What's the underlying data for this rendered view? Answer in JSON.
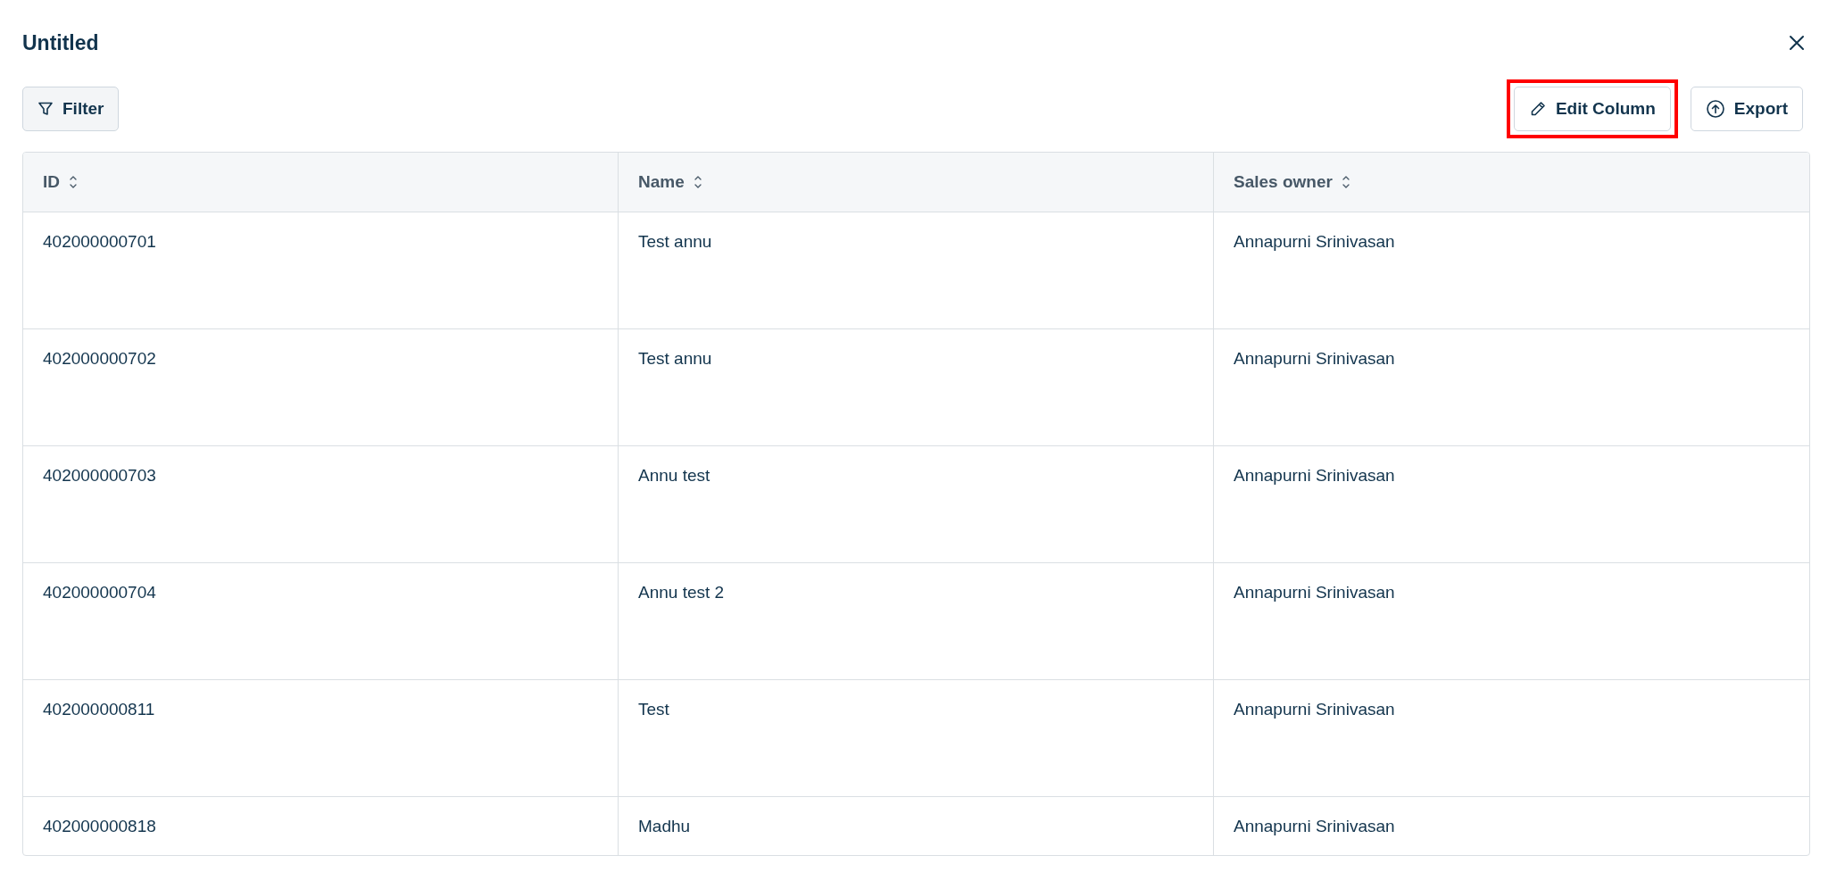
{
  "window": {
    "title": "Untitled"
  },
  "toolbar": {
    "filter": {
      "label": "Filter"
    },
    "buttons": [
      {
        "kind": "edit",
        "label": "Edit Column",
        "highlighted": true
      },
      {
        "kind": "export",
        "label": "Export",
        "highlighted": false
      }
    ]
  },
  "table": {
    "columns": [
      "ID",
      "Name",
      "Sales owner"
    ],
    "rows": [
      [
        "402000000701",
        "Test annu",
        "Annapurni Srinivasan"
      ],
      [
        "402000000702",
        "Test annu",
        "Annapurni Srinivasan"
      ],
      [
        "402000000703",
        "Annu test",
        "Annapurni Srinivasan"
      ],
      [
        "402000000704",
        "Annu test 2",
        "Annapurni Srinivasan"
      ],
      [
        "402000000811",
        "Test",
        "Annapurni Srinivasan"
      ],
      [
        "402000000818",
        "Madhu",
        "Annapurni Srinivasan"
      ]
    ]
  }
}
